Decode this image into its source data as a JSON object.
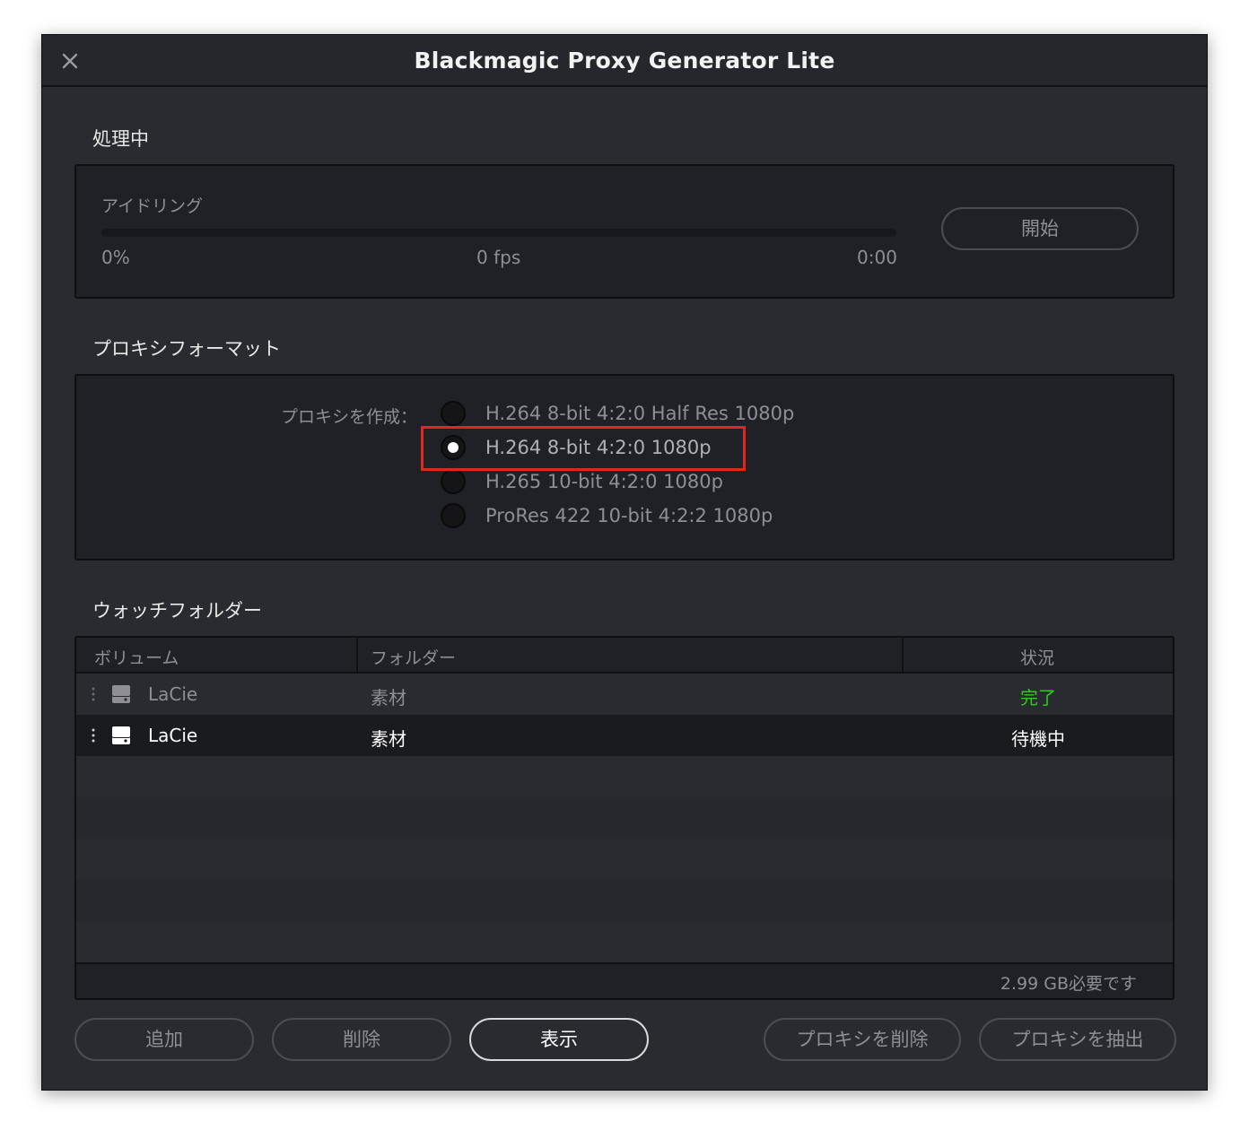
{
  "window": {
    "title": "Blackmagic Proxy Generator Lite"
  },
  "processing": {
    "section_title": "処理中",
    "status": "アイドリング",
    "progress_percent": 0,
    "percent_text": "0%",
    "fps_text": "0 fps",
    "time_text": "0:00",
    "start_button": "開始"
  },
  "proxy_format": {
    "section_title": "プロキシフォーマット",
    "create_label": "プロキシを作成：",
    "options": [
      {
        "label": "H.264 8-bit 4:2:0 Half Res 1080p",
        "selected": false
      },
      {
        "label": "H.264 8-bit 4:2:0 1080p",
        "selected": true
      },
      {
        "label": "H.265 10-bit 4:2:0 1080p",
        "selected": false
      },
      {
        "label": "ProRes 422 10-bit 4:2:2 1080p",
        "selected": false
      }
    ]
  },
  "watch_folders": {
    "section_title": "ウォッチフォルダー",
    "columns": {
      "volume": "ボリューム",
      "folder": "フォルダー",
      "status": "状況"
    },
    "rows": [
      {
        "volume": "LaCie",
        "folder": "素材",
        "status": "完了",
        "status_color": "#2ecc1a",
        "active": false
      },
      {
        "volume": "LaCie",
        "folder": "素材",
        "status": "待機中",
        "status_color": "#ffffff",
        "active": true
      }
    ],
    "footer": "2.99 GB必要です"
  },
  "buttons": {
    "add": "追加",
    "remove": "削除",
    "show": "表示",
    "delete_proxy": "プロキシを削除",
    "extract_proxy": "プロキシを抽出"
  },
  "colors": {
    "highlight": "#e0271c",
    "complete": "#2ecc1a"
  }
}
